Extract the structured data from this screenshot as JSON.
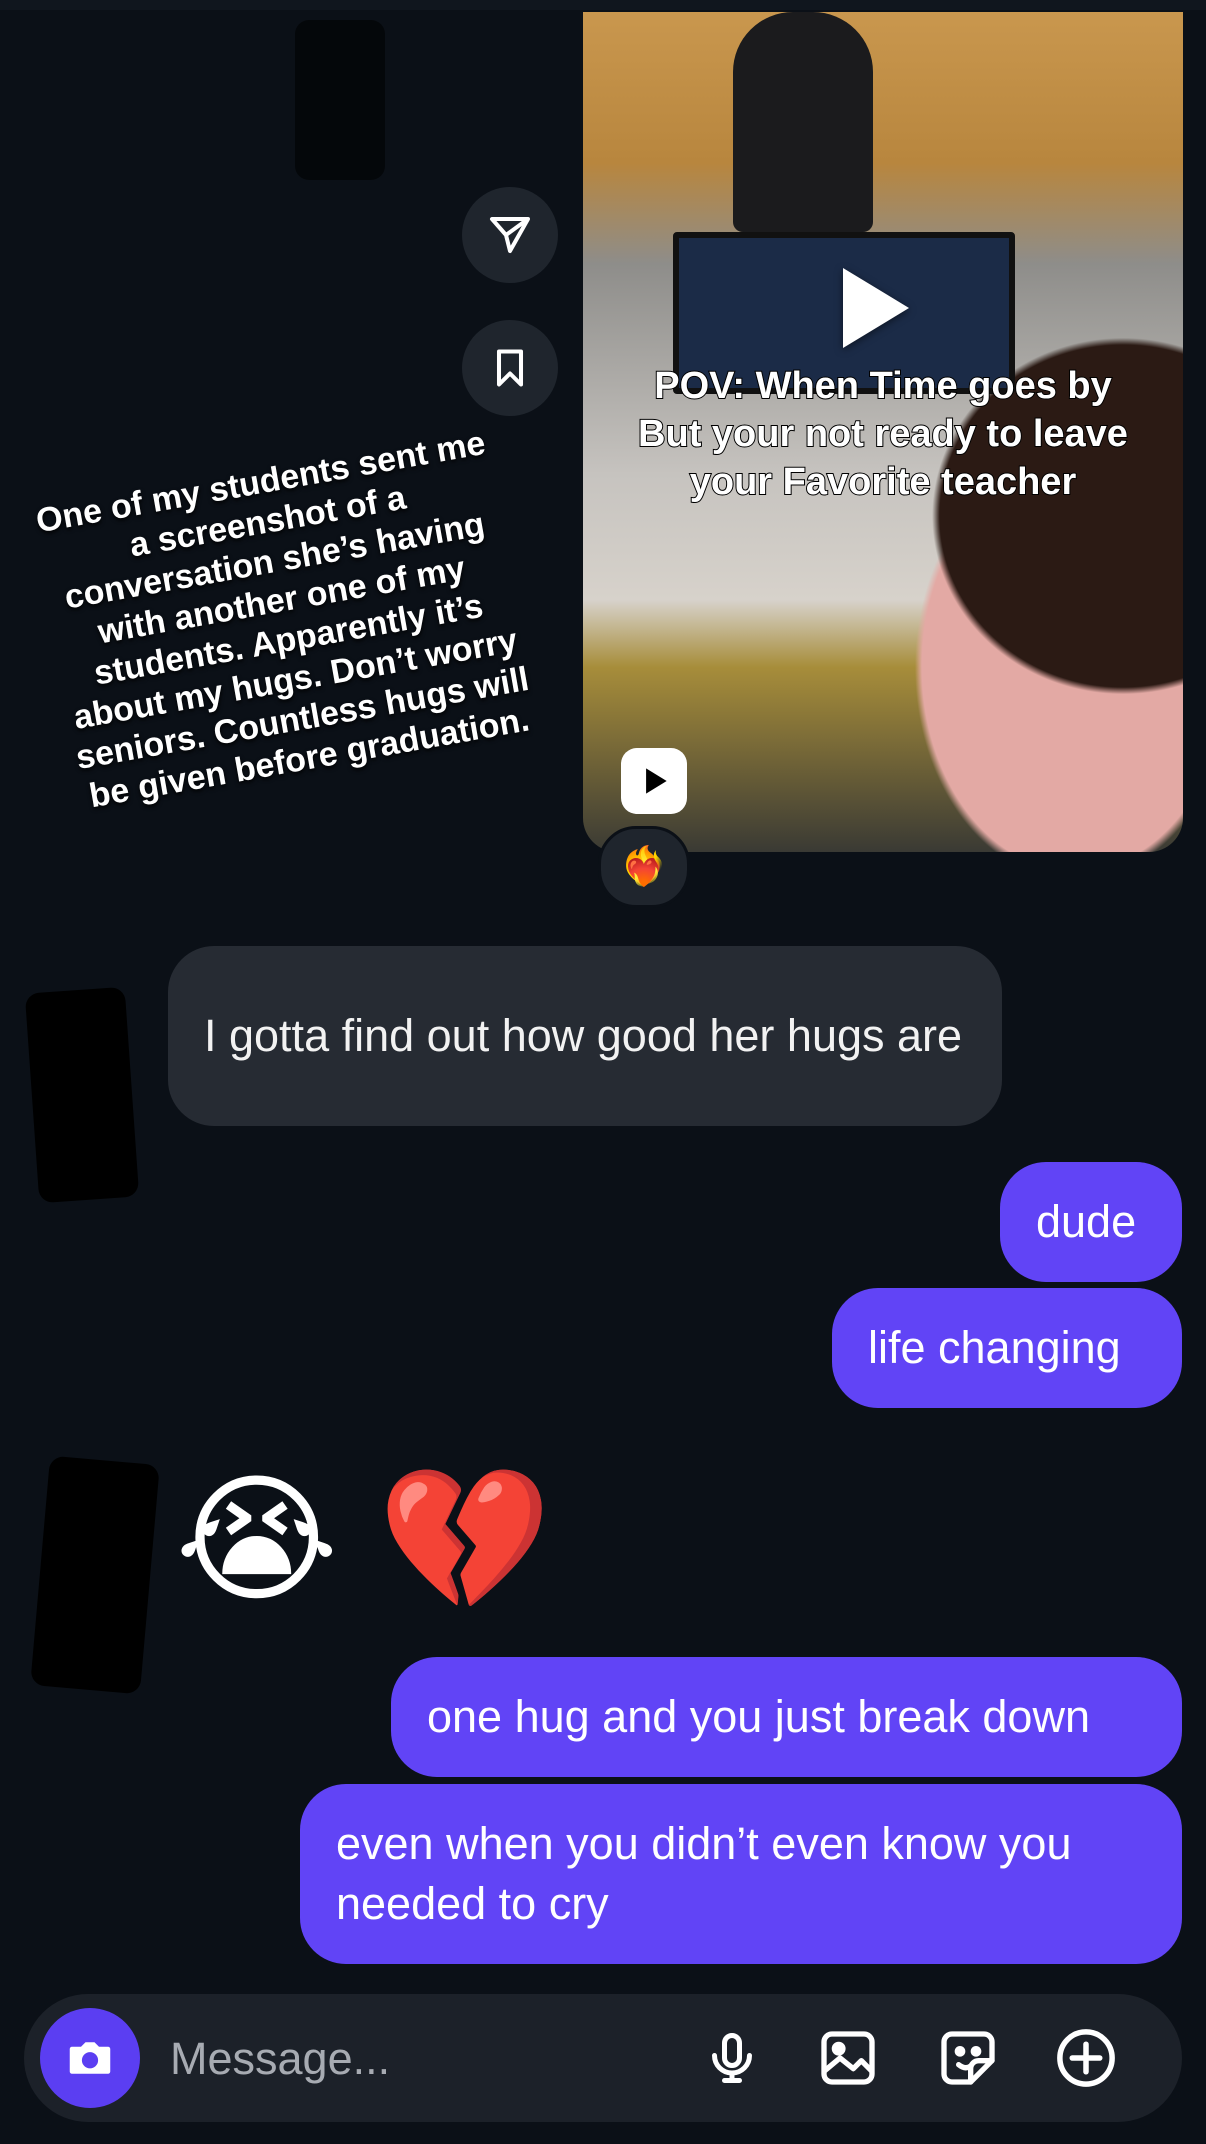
{
  "overlay": {
    "caption": "One of my students sent me a screenshot of a conversation she’s having with another one of my students. Apparently it’s about my hugs. Don’t worry seniors. Countless hugs will be given before graduation."
  },
  "shared_reel": {
    "caption_line1": "POV: When Time goes by",
    "caption_line2": "But your not ready to leave",
    "caption_line3": "your Favorite teacher",
    "reaction": "❤️‍🔥"
  },
  "messages": {
    "incoming_1": "I gotta find out how good her hugs are",
    "outgoing_1": "dude",
    "outgoing_2": "life changing",
    "incoming_emojis": "😭 💔",
    "outgoing_3": "one hug and you just break down",
    "outgoing_4": "even when you didn’t even know you needed to cry"
  },
  "composer": {
    "placeholder": "Message..."
  },
  "icons": {
    "share": "paper-plane-icon",
    "save": "bookmark-icon",
    "camera": "camera-icon",
    "mic": "microphone-icon",
    "gallery": "image-icon",
    "sticker": "sticker-icon",
    "more": "plus-circle-icon"
  },
  "colors": {
    "background": "#0b1017",
    "outgoing_bubble": "#6144f6",
    "incoming_bubble": "#262b33"
  }
}
